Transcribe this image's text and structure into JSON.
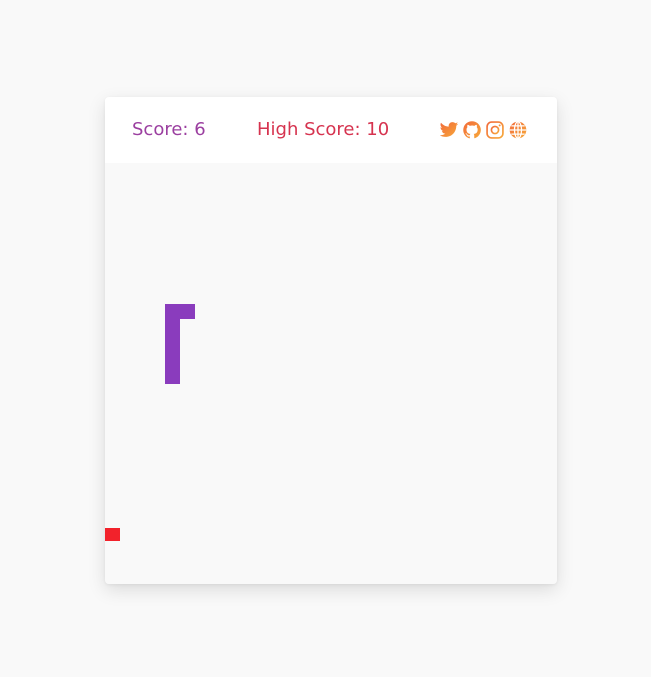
{
  "header": {
    "score_text": "Score: 6",
    "high_score_text": "High Score: 10"
  },
  "social_icons": [
    "twitter-icon",
    "github-icon",
    "instagram-icon",
    "globe-icon"
  ],
  "game": {
    "score": 6,
    "high_score": 10,
    "colors": {
      "snake": "#8a3cbd",
      "food": "#f2222b",
      "score_text": "#9b3fa0",
      "high_score_text": "#d6334f",
      "icons": "#f7943a"
    }
  }
}
